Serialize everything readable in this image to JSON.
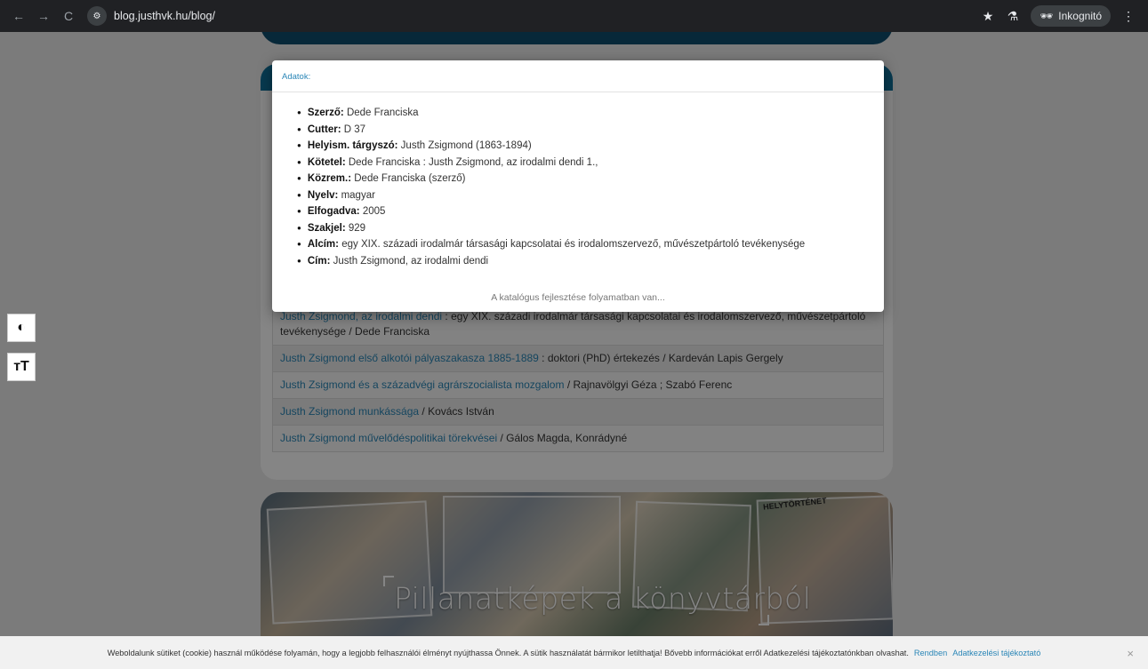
{
  "browser": {
    "back": "←",
    "forward": "→",
    "reload": "C",
    "url": "blog.justhvk.hu/blog/",
    "incognito_label": "Inkognitó"
  },
  "modal": {
    "title": "Adatok:",
    "fields": [
      {
        "label": "Szerző:",
        "value": "Dede Franciska"
      },
      {
        "label": "Cutter:",
        "value": "D 37"
      },
      {
        "label": "Helyism. tárgyszó:",
        "value": "Justh Zsigmond (1863-1894)"
      },
      {
        "label": "Kötetel:",
        "value": "Dede Franciska : Justh Zsigmond, az irodalmi dendi 1.,"
      },
      {
        "label": "Közrem.:",
        "value": "Dede Franciska (szerző)"
      },
      {
        "label": "Nyelv:",
        "value": "magyar"
      },
      {
        "label": "Elfogadva:",
        "value": "2005"
      },
      {
        "label": "Szakjel:",
        "value": "929"
      },
      {
        "label": "Alcím:",
        "value": "egy XIX. századi irodalmár társasági kapcsolatai és irodalomszervező, művészetpártoló tevékenysége"
      },
      {
        "label": "Cím:",
        "value": "Justh Zsigmond, az irodalmi dendi"
      }
    ],
    "footer": "A katalógus fejlesztése folyamatban van..."
  },
  "results": [
    {
      "title": "Justh Zsigmond, az irodalmi dendi",
      "rest": " : egy XIX. századi irodalmár társasági kapcsolatai és irodalomszervező, művészetpártoló tevékenysége / Dede Franciska"
    },
    {
      "title": "Justh Zsigmond első alkotói pályaszakasza 1885-1889",
      "rest": " : doktori (PhD) értekezés / Kardeván Lapis Gergely"
    },
    {
      "title": "Justh Zsigmond és a századvégi agrárszocialista mozgalom",
      "rest": " / Rajnavölgyi Géza ; Szabó Ferenc"
    },
    {
      "title": "Justh Zsigmond munkássága",
      "rest": " / Kovács István"
    },
    {
      "title": "Justh Zsigmond művelődéspolitikai törekvései",
      "rest": " / Gálos Magda, Konrádyné"
    }
  ],
  "banner": {
    "title": "Pillanatképek a könyvtárból",
    "sign_text": "HELYTÖRTÉNET"
  },
  "accessibility": {
    "contrast_icon": "contrast-icon",
    "text_size_icon": "text-size-icon",
    "text_size_glyph": "тT"
  },
  "cookie": {
    "text": "Weboldalunk sütiket (cookie) használ működése folyamán, hogy a legjobb felhasználói élményt nyújthassa Önnek. A sütik használatát bármikor letilthatja! Bővebb információkat erről Adatkezelési tájékoztatónkban olvashat.",
    "accept": "Rendben",
    "policy": "Adatkezelési tájékoztató",
    "close": "×"
  }
}
